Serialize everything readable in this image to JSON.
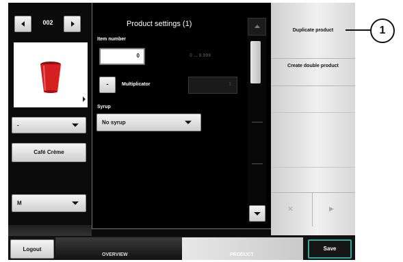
{
  "selector": {
    "value": "002"
  },
  "left": {
    "dropdown1": "-",
    "product_button": "Café Crème",
    "size_dropdown": "M"
  },
  "panel": {
    "title": "Product settings (1)",
    "item_number_label": "Item number",
    "item_number_value": "0",
    "item_number_range": "0 ... 9.999",
    "multiplicator_label": "Multiplicator",
    "multiplicator_button": "-",
    "multiplicator_value": "1",
    "syrup_label": "Syrup",
    "syrup_value": "No syrup"
  },
  "right": {
    "menu": [
      "Duplicate product",
      "Create double product"
    ],
    "close_symbol": "✕",
    "play_symbol": "▶"
  },
  "bottom": {
    "logout": "Logout",
    "tab_overview": "OVERVIEW",
    "tab_product": "PRODUCT",
    "save": "Save"
  },
  "callout": {
    "number": "1"
  },
  "icons": [
    "chevron-left-icon",
    "chevron-right-icon",
    "cup-icon",
    "dropdown-arrow-icon",
    "scroll-up-icon",
    "scroll-down-icon",
    "close-icon",
    "play-icon"
  ],
  "colors": {
    "cup": "#d42020",
    "save_border": "#2fa89a",
    "background": "#0b0b0b"
  }
}
